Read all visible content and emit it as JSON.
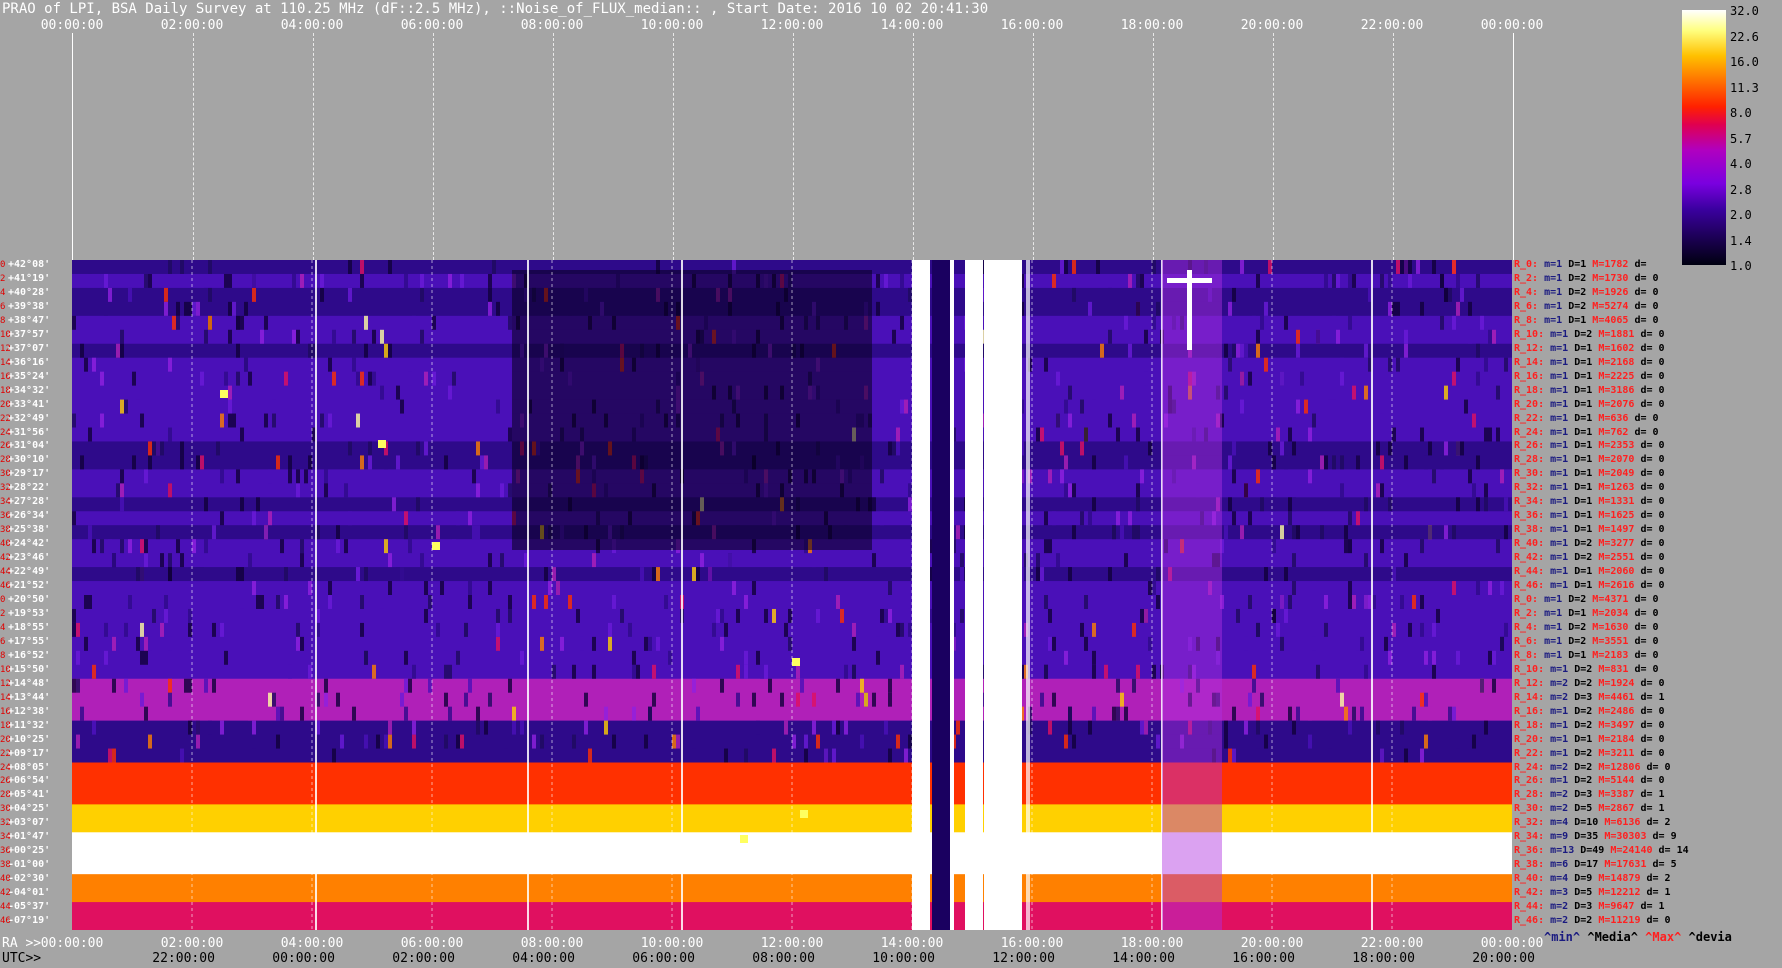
{
  "title": "PRAO of LPI, BSA Daily Survey at 110.25 MHz (dF::2.5 MHz), ::Noise_of_FLUX_median:: , Start Date: 2016 10 02 20:41:30",
  "top_ticks": [
    "00:00:00",
    "02:00:00",
    "04:00:00",
    "06:00:00",
    "08:00:00",
    "10:00:00",
    "12:00:00",
    "14:00:00",
    "16:00:00",
    "18:00:00",
    "20:00:00",
    "22:00:00",
    "00:00:00"
  ],
  "bottom_ra_label": "RA >>",
  "bottom_ra_ticks": [
    "00:00:00",
    "02:00:00",
    "04:00:00",
    "06:00:00",
    "08:00:00",
    "10:00:00",
    "12:00:00",
    "14:00:00",
    "16:00:00",
    "18:00:00",
    "20:00:00",
    "22:00:00",
    "00:00:00"
  ],
  "bottom_utc_label": "UTC>>",
  "bottom_utc_ticks": [
    "22:00:00",
    "00:00:00",
    "02:00:00",
    "04:00:00",
    "06:00:00",
    "08:00:00",
    "10:00:00",
    "12:00:00",
    "14:00:00",
    "16:00:00",
    "18:00:00",
    "20:00:00"
  ],
  "colorbar": {
    "labels": [
      "32.0",
      "22.6",
      "16.0",
      "11.3",
      "8.0",
      "5.7",
      "4.0",
      "2.8",
      "2.0",
      "1.4",
      "1.0"
    ]
  },
  "declinations": [
    {
      "i": "0",
      "d": "+42°08'"
    },
    {
      "i": "2",
      "d": "+41°19'"
    },
    {
      "i": "4",
      "d": "+40°28'"
    },
    {
      "i": "6",
      "d": "+39°38'"
    },
    {
      "i": "8",
      "d": "+38°47'"
    },
    {
      "i": "10",
      "d": "+37°57'"
    },
    {
      "i": "12",
      "d": "+37°07'"
    },
    {
      "i": "14",
      "d": "+36°16'"
    },
    {
      "i": "16",
      "d": "+35°24'"
    },
    {
      "i": "18",
      "d": "+34°32'"
    },
    {
      "i": "20",
      "d": "+33°41'"
    },
    {
      "i": "22",
      "d": "+32°49'"
    },
    {
      "i": "24",
      "d": "+31°56'"
    },
    {
      "i": "26",
      "d": "+31°04'"
    },
    {
      "i": "28",
      "d": "+30°10'"
    },
    {
      "i": "30",
      "d": "+29°17'"
    },
    {
      "i": "32",
      "d": "+28°22'"
    },
    {
      "i": "34",
      "d": "+27°28'"
    },
    {
      "i": "36",
      "d": "+26°34'"
    },
    {
      "i": "38",
      "d": "+25°38'"
    },
    {
      "i": "40",
      "d": "+24°42'"
    },
    {
      "i": "42",
      "d": "+23°46'"
    },
    {
      "i": "44",
      "d": "+22°49'"
    },
    {
      "i": "46",
      "d": "+21°52'"
    },
    {
      "i": "0",
      "d": "+20°50'"
    },
    {
      "i": "2",
      "d": "+19°53'"
    },
    {
      "i": "4",
      "d": "+18°55'"
    },
    {
      "i": "6",
      "d": "+17°55'"
    },
    {
      "i": "8",
      "d": "+16°52'"
    },
    {
      "i": "10",
      "d": "+15°50'"
    },
    {
      "i": "12",
      "d": "+14°48'"
    },
    {
      "i": "14",
      "d": "+13°44'"
    },
    {
      "i": "16",
      "d": "+12°38'"
    },
    {
      "i": "18",
      "d": "+11°32'"
    },
    {
      "i": "20",
      "d": "+10°25'"
    },
    {
      "i": "22",
      "d": "+09°17'"
    },
    {
      "i": "24",
      "d": "+08°05'"
    },
    {
      "i": "26",
      "d": "+06°54'"
    },
    {
      "i": "28",
      "d": "+05°41'"
    },
    {
      "i": "30",
      "d": "+04°25'"
    },
    {
      "i": "32",
      "d": "+03°07'"
    },
    {
      "i": "34",
      "d": "+01°47'"
    },
    {
      "i": "36",
      "d": "+00°25'"
    },
    {
      "i": "38",
      "d": "-01°00'"
    },
    {
      "i": "40",
      "d": "-02°30'"
    },
    {
      "i": "42",
      "d": "-04°01'"
    },
    {
      "i": "44",
      "d": "-05°37'"
    },
    {
      "i": "46",
      "d": "-07°19'"
    }
  ],
  "stats_rows": [
    {
      "r": "R_0:",
      "m": "m=1",
      "D": "D=1",
      "M": "M=1782",
      "d": "d="
    },
    {
      "r": "R_2:",
      "m": "m=1",
      "D": "D=2",
      "M": "M=1730",
      "d": "d= 0"
    },
    {
      "r": "R_4:",
      "m": "m=1",
      "D": "D=2",
      "M": "M=1926",
      "d": "d= 0"
    },
    {
      "r": "R_6:",
      "m": "m=1",
      "D": "D=2",
      "M": "M=5274",
      "d": "d= 0"
    },
    {
      "r": "R_8:",
      "m": "m=1",
      "D": "D=1",
      "M": "M=4065",
      "d": "d= 0"
    },
    {
      "r": "R_10:",
      "m": "m=1",
      "D": "D=2",
      "M": "M=1881",
      "d": "d= 0"
    },
    {
      "r": "R_12:",
      "m": "m=1",
      "D": "D=1",
      "M": "M=1602",
      "d": "d= 0"
    },
    {
      "r": "R_14:",
      "m": "m=1",
      "D": "D=1",
      "M": "M=2168",
      "d": "d= 0"
    },
    {
      "r": "R_16:",
      "m": "m=1",
      "D": "D=1",
      "M": "M=2225",
      "d": "d= 0"
    },
    {
      "r": "R_18:",
      "m": "m=1",
      "D": "D=1",
      "M": "M=3186",
      "d": "d= 0"
    },
    {
      "r": "R_20:",
      "m": "m=1",
      "D": "D=1",
      "M": "M=2076",
      "d": "d= 0"
    },
    {
      "r": "R_22:",
      "m": "m=1",
      "D": "D=1",
      "M": "M=636",
      "d": "d= 0"
    },
    {
      "r": "R_24:",
      "m": "m=1",
      "D": "D=1",
      "M": "M=762",
      "d": "d= 0"
    },
    {
      "r": "R_26:",
      "m": "m=1",
      "D": "D=1",
      "M": "M=2353",
      "d": "d= 0"
    },
    {
      "r": "R_28:",
      "m": "m=1",
      "D": "D=1",
      "M": "M=2070",
      "d": "d= 0"
    },
    {
      "r": "R_30:",
      "m": "m=1",
      "D": "D=1",
      "M": "M=2049",
      "d": "d= 0"
    },
    {
      "r": "R_32:",
      "m": "m=1",
      "D": "D=1",
      "M": "M=1263",
      "d": "d= 0"
    },
    {
      "r": "R_34:",
      "m": "m=1",
      "D": "D=1",
      "M": "M=1331",
      "d": "d= 0"
    },
    {
      "r": "R_36:",
      "m": "m=1",
      "D": "D=1",
      "M": "M=1625",
      "d": "d= 0"
    },
    {
      "r": "R_38:",
      "m": "m=1",
      "D": "D=1",
      "M": "M=1497",
      "d": "d= 0"
    },
    {
      "r": "R_40:",
      "m": "m=1",
      "D": "D=2",
      "M": "M=3277",
      "d": "d= 0"
    },
    {
      "r": "R_42:",
      "m": "m=1",
      "D": "D=2",
      "M": "M=2551",
      "d": "d= 0"
    },
    {
      "r": "R_44:",
      "m": "m=1",
      "D": "D=1",
      "M": "M=2060",
      "d": "d= 0"
    },
    {
      "r": "R_46:",
      "m": "m=1",
      "D": "D=1",
      "M": "M=2616",
      "d": "d= 0"
    },
    {
      "r": "R_0:",
      "m": "m=1",
      "D": "D=2",
      "M": "M=4371",
      "d": "d= 0"
    },
    {
      "r": "R_2:",
      "m": "m=1",
      "D": "D=1",
      "M": "M=2034",
      "d": "d= 0"
    },
    {
      "r": "R_4:",
      "m": "m=1",
      "D": "D=2",
      "M": "M=1630",
      "d": "d= 0"
    },
    {
      "r": "R_6:",
      "m": "m=1",
      "D": "D=2",
      "M": "M=3551",
      "d": "d= 0"
    },
    {
      "r": "R_8:",
      "m": "m=1",
      "D": "D=1",
      "M": "M=2183",
      "d": "d= 0"
    },
    {
      "r": "R_10:",
      "m": "m=1",
      "D": "D=2",
      "M": "M=831",
      "d": "d= 0"
    },
    {
      "r": "R_12:",
      "m": "m=2",
      "D": "D=2",
      "M": "M=1924",
      "d": "d= 0"
    },
    {
      "r": "R_14:",
      "m": "m=2",
      "D": "D=3",
      "M": "M=4461",
      "d": "d= 1"
    },
    {
      "r": "R_16:",
      "m": "m=1",
      "D": "D=2",
      "M": "M=2486",
      "d": "d= 0"
    },
    {
      "r": "R_18:",
      "m": "m=1",
      "D": "D=2",
      "M": "M=3497",
      "d": "d= 0"
    },
    {
      "r": "R_20:",
      "m": "m=1",
      "D": "D=1",
      "M": "M=2184",
      "d": "d= 0"
    },
    {
      "r": "R_22:",
      "m": "m=1",
      "D": "D=2",
      "M": "M=3211",
      "d": "d= 0"
    },
    {
      "r": "R_24:",
      "m": "m=2",
      "D": "D=2",
      "M": "M=12806",
      "d": "d= 0"
    },
    {
      "r": "R_26:",
      "m": "m=1",
      "D": "D=2",
      "M": "M=5144",
      "d": "d= 0"
    },
    {
      "r": "R_28:",
      "m": "m=2",
      "D": "D=3",
      "M": "M=3387",
      "d": "d= 1"
    },
    {
      "r": "R_30:",
      "m": "m=2",
      "D": "D=5",
      "M": "M=2867",
      "d": "d= 1"
    },
    {
      "r": "R_32:",
      "m": "m=4",
      "D": "D=10",
      "M": "M=6136",
      "d": "d= 2"
    },
    {
      "r": "R_34:",
      "m": "m=9",
      "D": "D=35",
      "M": "M=30303",
      "d": "d= 9"
    },
    {
      "r": "R_36:",
      "m": "m=13",
      "D": "D=49",
      "M": "M=24140",
      "d": "d= 14"
    },
    {
      "r": "R_38:",
      "m": "m=6",
      "D": "D=17",
      "M": "M=17631",
      "d": "d= 5"
    },
    {
      "r": "R_40:",
      "m": "m=4",
      "D": "D=9",
      "M": "M=14879",
      "d": "d= 2"
    },
    {
      "r": "R_42:",
      "m": "m=3",
      "D": "D=5",
      "M": "M=12212",
      "d": "d= 1"
    },
    {
      "r": "R_44:",
      "m": "m=2",
      "D": "D=3",
      "M": "M=9647",
      "d": "d= 1"
    },
    {
      "r": "R_46:",
      "m": "m=2",
      "D": "D=2",
      "M": "M=11219",
      "d": "d= 0"
    }
  ],
  "legend": {
    "min": "^min^",
    "media": "^Media^",
    "max": "^Max^",
    "devia": "^devia"
  },
  "colors": {
    "background": "#a5a5a5",
    "label_red": "#ff2020",
    "label_navy": "#1a1a80"
  }
}
